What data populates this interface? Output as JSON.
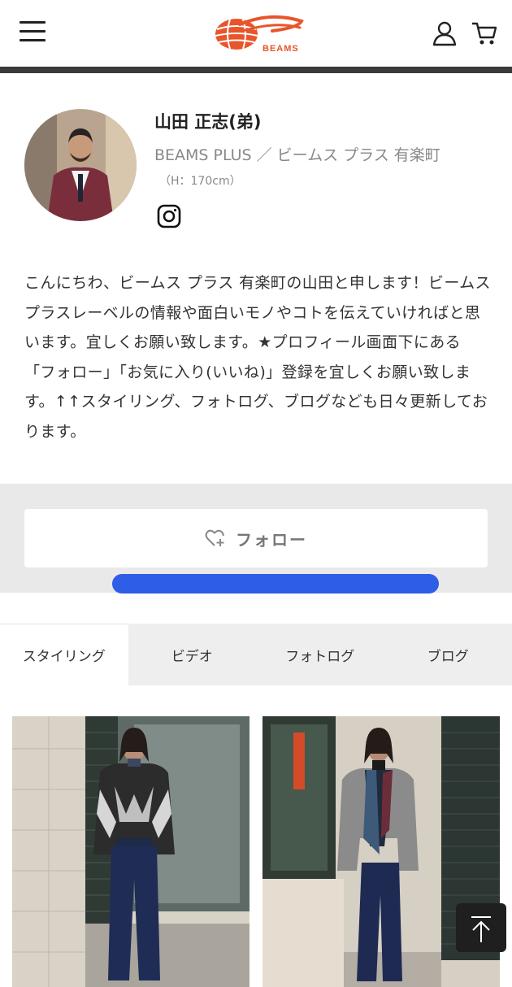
{
  "header": {
    "menu_icon": "hamburger-menu-icon",
    "logo_text": "BEAMS",
    "user_icon": "user-icon",
    "cart_icon": "cart-icon"
  },
  "profile": {
    "name": "山田 正志(弟)",
    "shop": "BEAMS PLUS ／ ビームス プラス 有楽町",
    "height": "（H：170cm）",
    "social_icon": "instagram-icon",
    "bio": "こんにちわ、ビームス プラス 有楽町の山田と申します！ビームス プラスレーベルの情報や面白いモノやコトを伝えていければと思います。宜しくお願い致します。★プロフィール画面下にある「フォロー」「お気に入り(いいね)」登録を宜しくお願い致します。↑↑スタイリング、フォトログ、ブログなども日々更新しております。"
  },
  "follow": {
    "label": "フォロー",
    "icon": "heart-plus-icon"
  },
  "tabs": [
    {
      "label": "スタイリング",
      "active": true
    },
    {
      "label": "ビデオ",
      "active": false
    },
    {
      "label": "フォトログ",
      "active": false
    },
    {
      "label": "ブログ",
      "active": false
    }
  ],
  "colors": {
    "brand_orange": "#e8552a",
    "scribble_blue": "#2e5de6",
    "follow_area_bg": "#e9e9e9"
  },
  "back_to_top_icon": "arrow-up-icon"
}
